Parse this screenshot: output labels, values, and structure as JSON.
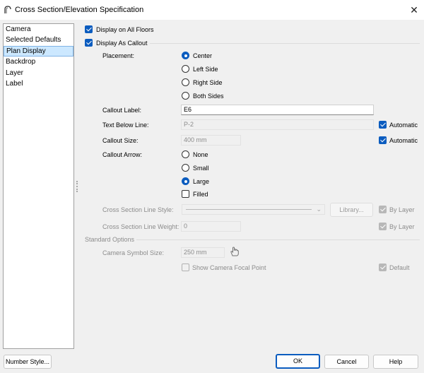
{
  "window": {
    "title": "Cross Section/Elevation Specification",
    "close_glyph": "✕"
  },
  "sidebar": {
    "items": [
      {
        "label": "Camera"
      },
      {
        "label": "Selected Defaults"
      },
      {
        "label": "Plan Display",
        "selected": true
      },
      {
        "label": "Backdrop"
      },
      {
        "label": "Layer"
      },
      {
        "label": "Label"
      }
    ]
  },
  "options": {
    "display_all_floors": {
      "label": "Display on All Floors",
      "checked": true
    },
    "display_as_callout": {
      "label": "Display As Callout",
      "checked": true
    }
  },
  "placement": {
    "label": "Placement:",
    "choices": [
      "Center",
      "Left Side",
      "Right Side",
      "Both Sides"
    ],
    "selected": "Center"
  },
  "callout_label": {
    "label": "Callout Label:",
    "value": "E6"
  },
  "text_below_line": {
    "label": "Text Below Line:",
    "value": "P-2",
    "automatic_label": "Automatic",
    "automatic": true
  },
  "callout_size": {
    "label": "Callout Size:",
    "value": "400 mm",
    "automatic_label": "Automatic",
    "automatic": true
  },
  "callout_arrow": {
    "label": "Callout Arrow:",
    "choices": [
      "None",
      "Small",
      "Large"
    ],
    "selected": "Large",
    "filled_label": "Filled",
    "filled": false
  },
  "section_line_style": {
    "label": "Cross Section Line Style:",
    "library_button": "Library...",
    "by_layer_label": "By Layer",
    "by_layer": true
  },
  "section_line_weight": {
    "label": "Cross Section Line Weight:",
    "value": "0",
    "by_layer_label": "By Layer",
    "by_layer": true
  },
  "standard_options": {
    "heading": "Standard Options",
    "camera_symbol_size_label": "Camera Symbol Size:",
    "camera_symbol_size_value": "250 mm",
    "show_focal_point_label": "Show Camera Focal Point",
    "show_focal_point": false,
    "default_label": "Default",
    "default": true
  },
  "footer": {
    "number_style": "Number Style...",
    "ok": "OK",
    "cancel": "Cancel",
    "help": "Help"
  },
  "colors": {
    "accent": "#0b5cbf",
    "selection": "#cce8ff",
    "disabled_text": "#8c8c8c"
  }
}
